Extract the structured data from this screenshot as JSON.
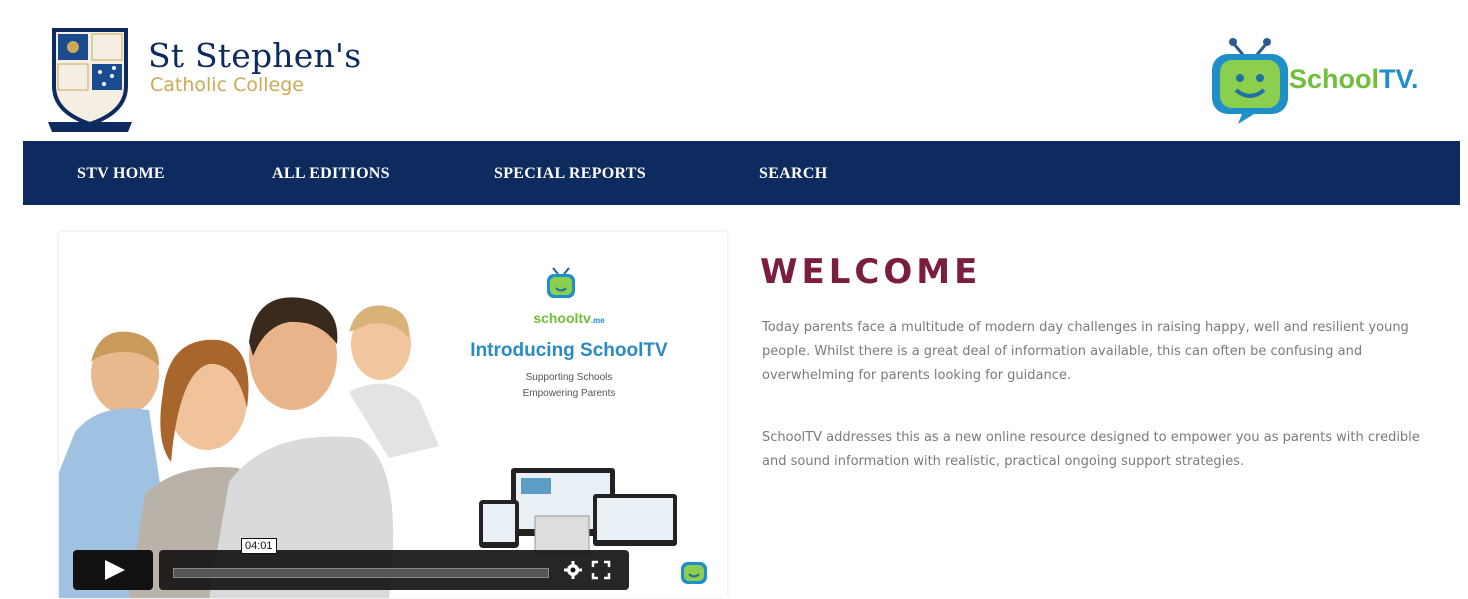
{
  "header": {
    "school_name_line1": "St Stephen's",
    "school_name_line2": "Catholic College",
    "crest_icon": "school-crest-icon",
    "partner_logo_name_a": "School",
    "partner_logo_name_b": "TV.",
    "partner_logo_icon": "tv-mascot-icon"
  },
  "nav": {
    "items": [
      {
        "label": "STV HOME"
      },
      {
        "label": "ALL EDITIONS"
      },
      {
        "label": "SPECIAL REPORTS"
      },
      {
        "label": "SEARCH"
      }
    ]
  },
  "video": {
    "promo_brand": "schooltv",
    "promo_brand_suffix": ".me",
    "promo_headline": "Introducing SchoolTV",
    "promo_line1": "Supporting Schools",
    "promo_line2": "Empowering Parents",
    "duration": "04:01",
    "play_icon": "play-icon",
    "settings_icon": "gear-icon",
    "fullscreen_icon": "fullscreen-icon"
  },
  "welcome": {
    "title": "WELCOME",
    "paragraph1": "Today parents face a multitude of modern day challenges in raising happy, well and resilient young people. Whilst there is a great deal of information available, this can often be confusing and overwhelming for parents looking for guidance.",
    "paragraph2": "SchoolTV addresses this as a new online resource designed to empower you as parents with credible and sound information with realistic, practical ongoing support strategies."
  },
  "colors": {
    "nav_bg": "#0d2b5e",
    "title_color": "#7a1d3e",
    "brand_green": "#6fbf3b",
    "brand_blue": "#1f8fc9"
  }
}
